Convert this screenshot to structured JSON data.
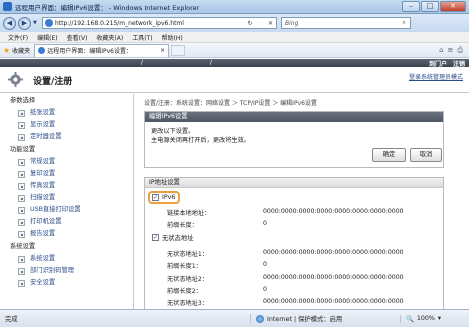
{
  "window": {
    "title": "远程用户界面：编辑IPv6设置：                     - Windows Internet Explorer",
    "minimize": "–",
    "maximize": "□",
    "close": "✕"
  },
  "address": {
    "url": "http://192.168.0.215/m_network_ipv6.html",
    "search_placeholder": "Bing",
    "refresh": "↻",
    "stop": "✕"
  },
  "menu": [
    "文件(F)",
    "编辑(E)",
    "查看(V)",
    "收藏夹(A)",
    "工具(T)",
    "帮助(H)"
  ],
  "favorites": {
    "label": "收藏夹",
    "tab_title": "远程用户界面：编辑IPv6设置：",
    "tab_close": "×"
  },
  "header": {
    "slash": "/",
    "portal": "到门户",
    "logout": "注销",
    "title": "设置/注册",
    "sysadmin_link": "登录系统管理员模式"
  },
  "sidebar": {
    "sections": [
      {
        "title": "参数选择",
        "items": [
          "纸张设置",
          "显示设置",
          "定时器设置"
        ]
      },
      {
        "title": "功能设置",
        "items": [
          "常规设置",
          "复印设置",
          "传真设置",
          "扫描设置",
          "USB直接打印设置",
          "打印机设置",
          "报告设置"
        ]
      },
      {
        "title": "系统设置",
        "items": [
          "系统设置",
          "部门识别码管理",
          "安全设置"
        ]
      }
    ]
  },
  "main": {
    "breadcrumb": "设置/注册：系统设置：网络设置 ＞ TCP/IP设置 ＞ 编辑IPv6设置",
    "panel_title": "编辑IPv6设置",
    "message1": "更改以下设置。",
    "message2": "主电源关闭再打开后，更改将生效。",
    "ok": "确定",
    "cancel": "取消",
    "ip_section": "IP地址设置",
    "ipv6_label": "IPv6",
    "link_local_label": "链接本地地址：",
    "link_local_value": "0000:0000:0000:0000:0000:0000:0000:0000",
    "prefix_label": "前缀长度：",
    "prefix_value": "0",
    "stateless_label": "无状态地址",
    "stateless_addr1_label": "无状态地址1：",
    "stateless_addr1_value": "0000:0000:0000:0000:0000:0000:0000:0000",
    "prefix1_label": "前缀长度1：",
    "prefix1_value": "0",
    "stateless_addr2_label": "无状态地址2：",
    "stateless_addr2_value": "0000:0000:0000:0000:0000:0000:0000:0000",
    "prefix2_label": "前缀长度2：",
    "prefix2_value": "0",
    "stateless_addr3_label": "无状态地址3：",
    "stateless_addr3_value": "0000:0000:0000:0000:0000:0000:0000:0000",
    "ipv6_checked": true,
    "stateless_checked": true
  },
  "status": {
    "done": "完成",
    "zone": "Internet | 保护模式：启用",
    "zoom": "100%"
  },
  "colors": {
    "highlight": "#e8a040",
    "panel_header": "#4f5664",
    "link": "#2a4a8a"
  }
}
